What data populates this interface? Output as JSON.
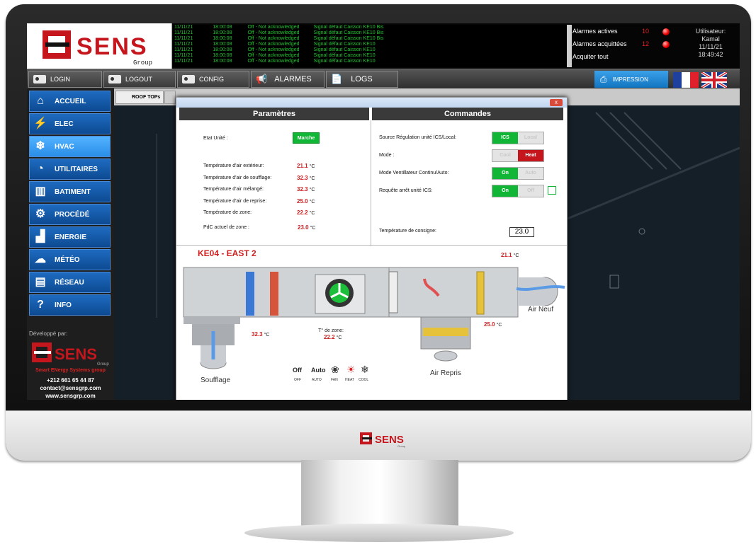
{
  "brand": {
    "name": "SENS",
    "sub": "Group"
  },
  "log": {
    "rows": [
      {
        "date": "11/11/21",
        "time": "18:00:08",
        "status": "Off - Not acknowledged",
        "message": "Signal défaut Caisson KE10 Bis"
      },
      {
        "date": "11/11/21",
        "time": "18:00:08",
        "status": "Off - Not acknowledged",
        "message": "Signal défaut Caisson KE10 Bis"
      },
      {
        "date": "11/11/21",
        "time": "18:00:08",
        "status": "Off - Not acknowledged",
        "message": "Signal défaut Caisson KE10 Bis"
      },
      {
        "date": "11/11/21",
        "time": "18:00:08",
        "status": "Off - Not acknowledged",
        "message": "Signal défaut Caisson KE10"
      },
      {
        "date": "11/11/21",
        "time": "18:00:08",
        "status": "Off - Not acknowledged",
        "message": "Signal défaut Caisson KE10"
      },
      {
        "date": "11/11/21",
        "time": "18:00:08",
        "status": "Off - Not acknowledged",
        "message": "Signal défaut Caisson KE10"
      },
      {
        "date": "11/11/21",
        "time": "18:00:08",
        "status": "Off - Not acknowledged",
        "message": "Signal défaut Caisson KE10"
      }
    ]
  },
  "alarms": {
    "active_label": "Alarmes actives",
    "active_count": "10",
    "acked_label": "Alarmes acquittées",
    "acked_count": "12",
    "ack_all": "Acquiter tout"
  },
  "user": {
    "label": "Utilisateur:",
    "name": "Kamal",
    "date": "11/11/21",
    "time": "18:49:42"
  },
  "toolbar": {
    "login": "LOGIN",
    "logout": "LOGOUT",
    "config": "CONFIG",
    "alarmes": "ALARMES",
    "logs": "LOGS",
    "impression": "IMPRESSION"
  },
  "nav": {
    "items": [
      {
        "label": "ACCUEIL",
        "icon": "home-icon"
      },
      {
        "label": "ELEC",
        "icon": "lightning-icon"
      },
      {
        "label": "HVAC",
        "icon": "thermometer-snow-icon"
      },
      {
        "label": "UTILITAIRES",
        "icon": "gauge-icon"
      },
      {
        "label": "BATIMENT",
        "icon": "building-icon"
      },
      {
        "label": "PROCÉDÉ",
        "icon": "gears-icon"
      },
      {
        "label": "ENERGIE",
        "icon": "chart-icon"
      },
      {
        "label": "MÉTÉO",
        "icon": "cloud-icon"
      },
      {
        "label": "RÉSEAU",
        "icon": "network-icon"
      },
      {
        "label": "INFO",
        "icon": "help-icon"
      }
    ],
    "active": "HVAC"
  },
  "developer": {
    "label": "Développé par:",
    "tagline": "Smart ENergy Systems group",
    "phone": "+212 661 65 44 87",
    "email": "contact@sensgrp.com",
    "web": "www.sensgrp.com"
  },
  "tab": {
    "label": "ROOF TOPs"
  },
  "panel": {
    "params_title": "Paramètres",
    "commands_title": "Commandes",
    "etat_label": "Etat Unité :",
    "etat_value": "Marche",
    "temps": [
      {
        "label": "Température d'air extérieur:",
        "value": "21.1",
        "unit": "°C"
      },
      {
        "label": "Température d'air de soufflage:",
        "value": "32.3",
        "unit": "°C"
      },
      {
        "label": "Température d'air mélangé:",
        "value": "32.3",
        "unit": "°C"
      },
      {
        "label": "Température d'air de reprise:",
        "value": "25.0",
        "unit": "°C"
      },
      {
        "label": "Température de zone:",
        "value": "22.2",
        "unit": "°C"
      }
    ],
    "pdc_label": "PdC actuel de zone :",
    "pdc_value": "23.0",
    "pdc_unit": "°C",
    "commands": [
      {
        "label": "Source Régulation unité ICS/Local:",
        "on": "ICS",
        "off": "Local"
      },
      {
        "label": "Mode :",
        "on": "Cool",
        "off": "Heat"
      },
      {
        "label": "Mode Ventillateur Continu/Auto:",
        "on": "On",
        "off": "Auto"
      },
      {
        "label": "Requête arrêt unité ICS:",
        "on": "On",
        "off": "Off"
      }
    ],
    "setpoint_label": "Température de consigne:",
    "setpoint_value": "23.0"
  },
  "diagram": {
    "title": "KE04 - EAST 2",
    "outside_temp": "21.1",
    "supply_temp": "32.3",
    "return_temp": "25.0",
    "zone_label": "T° de zone:",
    "zone_temp": "22.2",
    "unit": "°C",
    "air_neuf": "Air Neuf",
    "air_repris": "Air Repris",
    "soufflage": "Soufflage",
    "legend": {
      "off": "Off",
      "auto": "Auto",
      "off_s": "OFF",
      "auto_s": "AUTO",
      "fan": "FAN",
      "heat": "HEAT",
      "cool": "COOL"
    }
  }
}
